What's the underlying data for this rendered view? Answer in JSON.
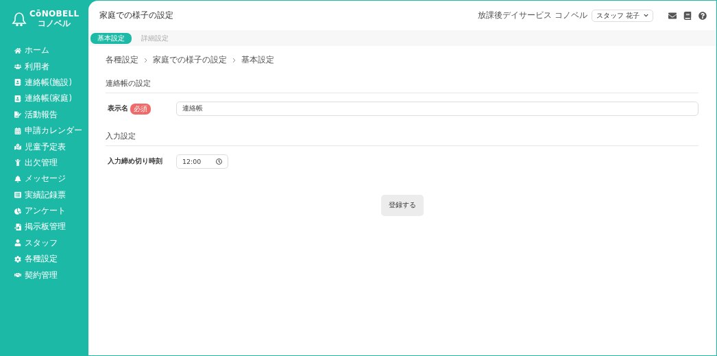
{
  "logo": {
    "name": "CōNOBELL",
    "kana": "コノベル"
  },
  "sidebar": {
    "items": [
      {
        "label": "ホーム"
      },
      {
        "label": "利用者"
      },
      {
        "label": "連絡帳(施設)"
      },
      {
        "label": "連絡帳(家庭)"
      },
      {
        "label": "活動報告"
      },
      {
        "label": "申請カレンダー"
      },
      {
        "label": "児童予定表"
      },
      {
        "label": "出欠管理"
      },
      {
        "label": "メッセージ"
      },
      {
        "label": "実績記録票"
      },
      {
        "label": "アンケート"
      },
      {
        "label": "掲示板管理"
      },
      {
        "label": "スタッフ"
      },
      {
        "label": "各種設定"
      },
      {
        "label": "契約管理"
      }
    ]
  },
  "header": {
    "title": "家庭での様子の設定",
    "facility": "放課後デイサービス コノベル",
    "user": "スタッフ 花子"
  },
  "tabs": [
    {
      "label": "基本設定",
      "selected": true
    },
    {
      "label": "詳細設定",
      "selected": false
    }
  ],
  "breadcrumb": [
    "各種設定",
    "家庭での様子の設定",
    "基本設定"
  ],
  "sections": [
    {
      "title": "連絡帳の設定",
      "field": {
        "label": "表示名",
        "required_badge": "必須",
        "value": "連絡帳",
        "kind": "text"
      }
    },
    {
      "title": "入力設定",
      "field": {
        "label": "入力締め切り時刻",
        "value": "12:00",
        "kind": "time"
      }
    }
  ],
  "submit": "登録する"
}
